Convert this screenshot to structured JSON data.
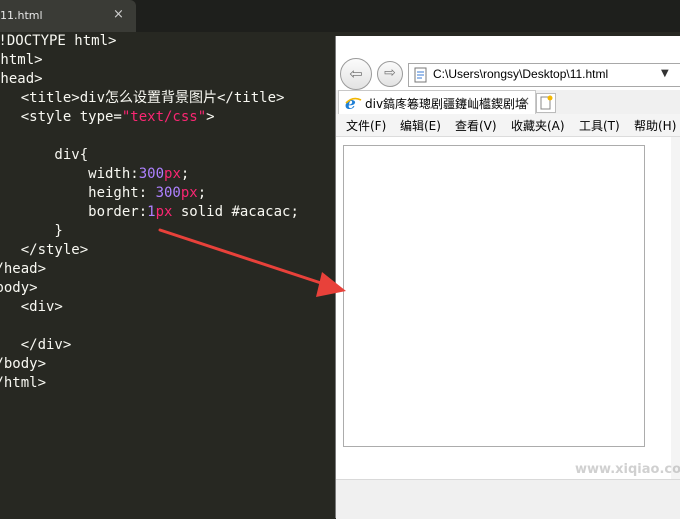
{
  "editor": {
    "tab_name": "11.html",
    "tab_close": "×",
    "lines": [
      "<!DOCTYPE html>",
      "<html>",
      "<head>",
      "    <title>div怎么设置背景图片</title>",
      "    <style type=\"text/css\">",
      "",
      "        div{",
      "            width:300px;",
      "            height: 300px;",
      "            border:1px solid #acacac;",
      "        }",
      "    </style>",
      "</head>",
      "<body>",
      "    <div>",
      "",
      "    </div>",
      "</body>",
      "</html>"
    ],
    "colors": {
      "background": "#272822",
      "text": "#f8f8f2",
      "number": "#ae81ff",
      "string": "#e6db74",
      "tag": "#f92672"
    }
  },
  "annotation": {
    "arrow_color": "#e8413a"
  },
  "browser": {
    "back_icon": "back-arrow-icon",
    "forward_icon": "forward-arrow-icon",
    "back_glyph": "⇦",
    "forward_glyph": "⇨",
    "address": "C:\\Users\\rongsy\\Desktop\\11.html",
    "address_dropdown": "▼",
    "tab_title": "div鎬庝箞璁剧疆鑳屾櫙鍥剧墖",
    "tab_close": "×",
    "menu": [
      "文件(F)",
      "编辑(E)",
      "查看(V)",
      "收藏夹(A)",
      "工具(T)",
      "帮助(H)"
    ],
    "demo_div_border_color": "#acacac",
    "watermark": "www.xiqiao.com"
  }
}
